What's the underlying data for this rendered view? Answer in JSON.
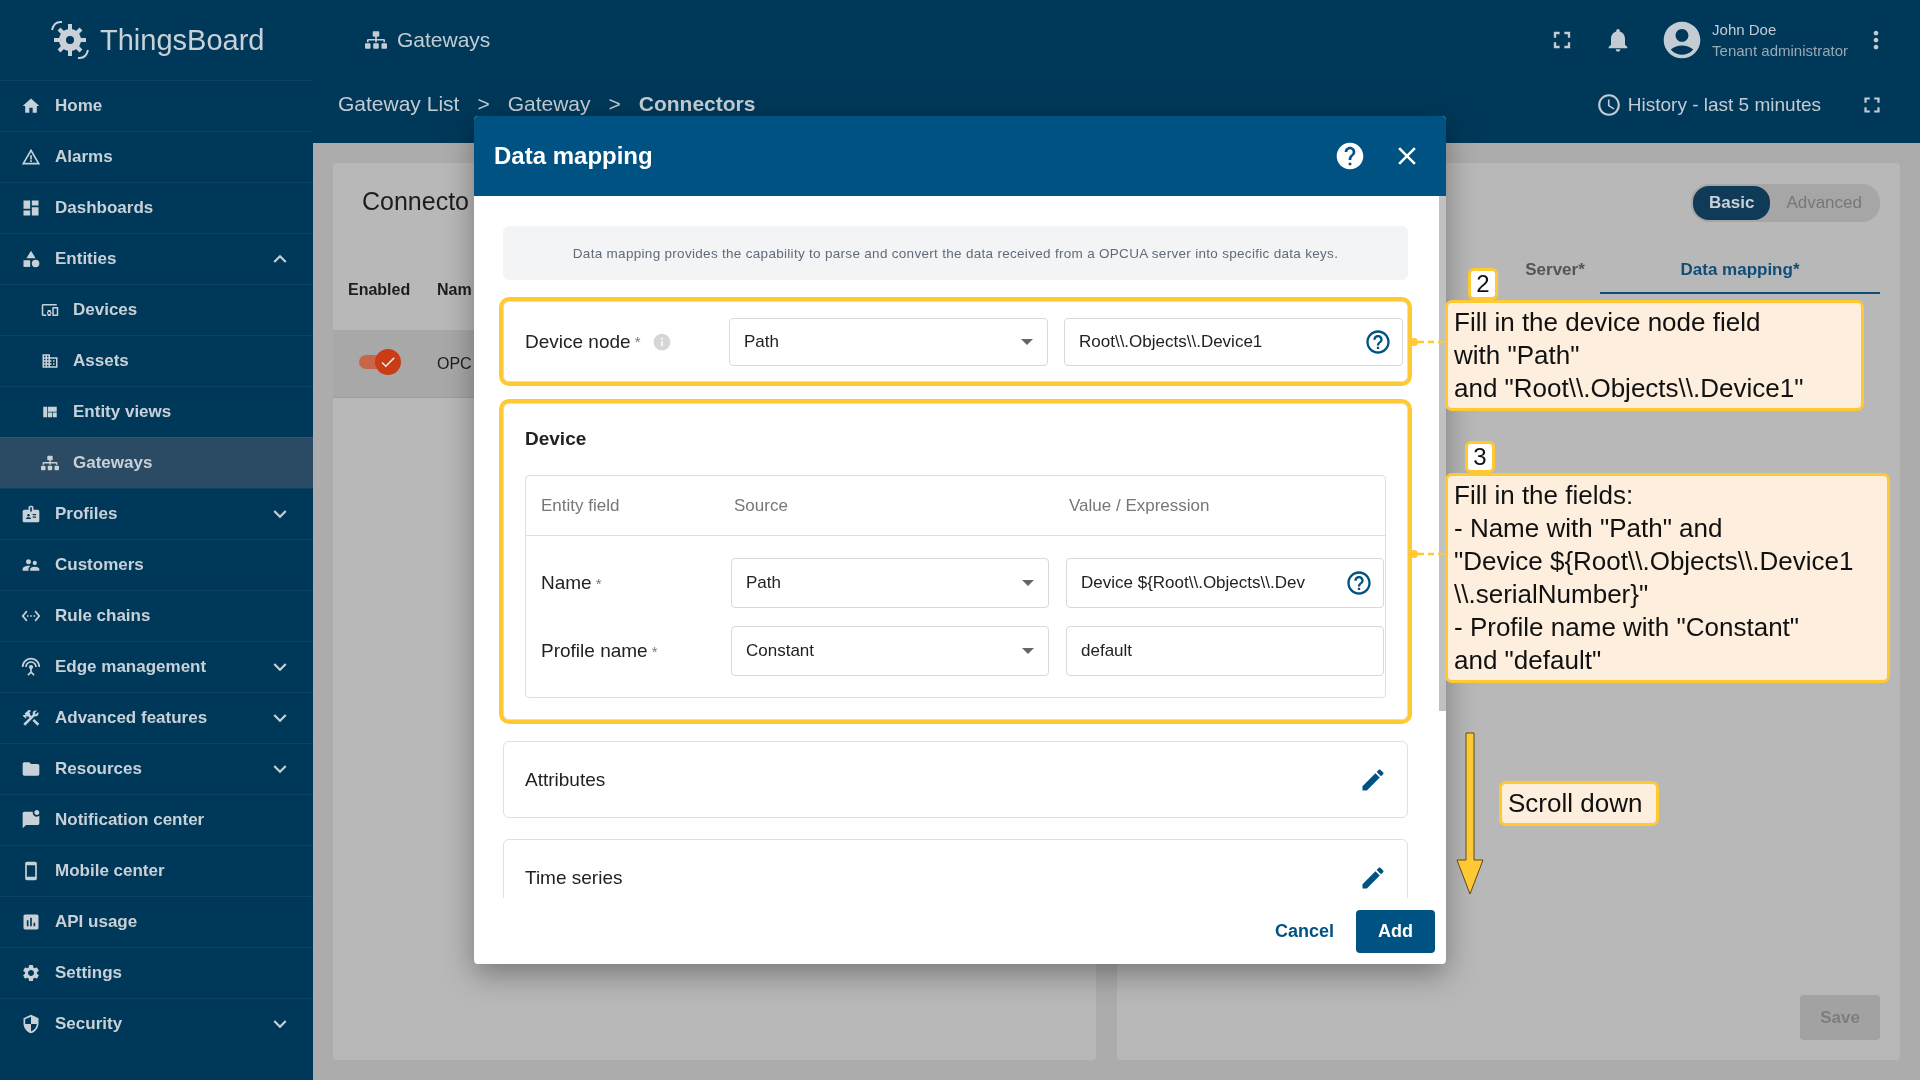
{
  "sidebar": {
    "logo": "ThingsBoard",
    "items": [
      {
        "label": "Home",
        "selected": false
      },
      {
        "label": "Alarms",
        "selected": false
      },
      {
        "label": "Dashboards",
        "selected": false
      },
      {
        "label": "Entities",
        "selected": false,
        "expanded": true,
        "children": [
          {
            "label": "Devices",
            "selected": false
          },
          {
            "label": "Assets",
            "selected": false
          },
          {
            "label": "Entity views",
            "selected": false
          },
          {
            "label": "Gateways",
            "selected": true
          }
        ]
      },
      {
        "label": "Profiles",
        "selected": false,
        "expanded": false
      },
      {
        "label": "Customers",
        "selected": false
      },
      {
        "label": "Rule chains",
        "selected": false
      },
      {
        "label": "Edge management",
        "selected": false,
        "expanded": false
      },
      {
        "label": "Advanced features",
        "selected": false,
        "expanded": false
      },
      {
        "label": "Resources",
        "selected": false,
        "expanded": false
      },
      {
        "label": "Notification center",
        "selected": false
      },
      {
        "label": "Mobile center",
        "selected": false
      },
      {
        "label": "API usage",
        "selected": false
      },
      {
        "label": "Settings",
        "selected": false
      },
      {
        "label": "Security",
        "selected": false,
        "expanded": false
      }
    ]
  },
  "top_bar": {
    "title": "Gateways",
    "user": {
      "name": "John Doe",
      "role": "Tenant administrator"
    }
  },
  "breadcrumb": [
    {
      "label": "Gateway List",
      "current": false,
      "separator": ">"
    },
    {
      "label": "Gateway",
      "current": false,
      "separator": ">"
    },
    {
      "label": "Connectors",
      "current": true
    }
  ],
  "history": "History - last 5 minutes",
  "connectors_card": {
    "title": "Connecto",
    "columns": [
      "Enabled",
      "Nam"
    ],
    "rows": [
      {
        "enabled": true,
        "name": "OPC",
        "selected": true
      }
    ]
  },
  "settings_card": {
    "modes": [
      {
        "label": "Basic",
        "selected": true
      },
      {
        "label": "Advanced",
        "selected": false
      }
    ],
    "tabs": [
      {
        "label": "Server*",
        "selected": false
      },
      {
        "label": "Data mapping*",
        "selected": true
      }
    ],
    "save": {
      "label": "Save",
      "disabled": true
    }
  },
  "dialog": {
    "title": "Data mapping",
    "info": "Data mapping provides the capability to parse and convert the data received from a OPCUA server into specific data keys.",
    "device_node": {
      "label": "Device node",
      "required_mark": "*",
      "source": "Path",
      "value": "Root\\\\.Objects\\\\.Device1",
      "highlighted": true
    },
    "device": {
      "title": "Device",
      "highlighted": true,
      "columns": [
        "Entity field",
        "Source",
        "Value / Expression"
      ],
      "rows": [
        {
          "field": "Name",
          "required_mark": "*",
          "source": "Path",
          "value": "Device ${Root\\\\.Objects\\\\.Dev",
          "help": true
        },
        {
          "field": "Profile name",
          "required_mark": "*",
          "source": "Constant",
          "value": "default",
          "help": false
        }
      ]
    },
    "sections": [
      "Attributes",
      "Time series"
    ],
    "buttons": {
      "cancel": "Cancel",
      "add": "Add"
    }
  },
  "annotations": [
    {
      "kind": "callout",
      "number": "2",
      "text": "Fill in the device node field\nwith \"Path\"\nand \"Root\\\\.Objects\\\\.Device1\""
    },
    {
      "kind": "callout",
      "number": "3",
      "text": "Fill in the fields:\n- Name with \"Path\" and\n\"Device ${Root\\\\.Objects\\\\.Device1\n\\\\.serialNumber}\"\n- Profile name with \"Constant\"\nand \"default\""
    },
    {
      "kind": "arrow-note",
      "text": "Scroll down"
    }
  ]
}
